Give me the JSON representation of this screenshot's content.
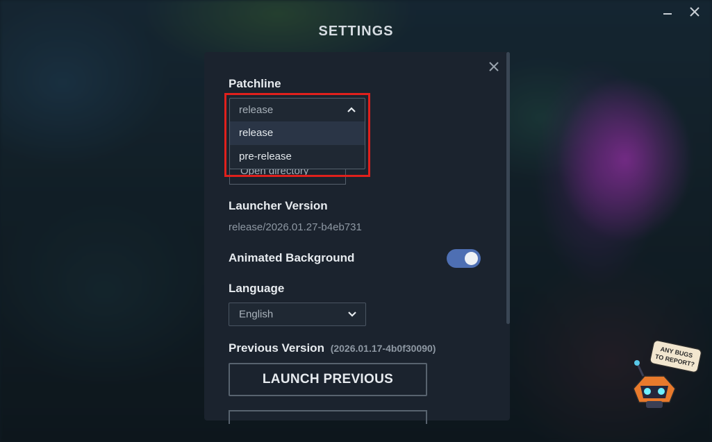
{
  "window": {
    "title": "SETTINGS",
    "minimize_icon": "minimize-icon",
    "close_icon": "close-icon"
  },
  "panel": {
    "close_icon": "close-icon",
    "patchline": {
      "label": "Patchline",
      "selected": "release",
      "options": [
        "release",
        "pre-release"
      ],
      "expanded": true
    },
    "open_directory": {
      "label": "Open directory"
    },
    "launcher_version": {
      "label": "Launcher Version",
      "value": "release/2026.01.27-b4eb731"
    },
    "animated_background": {
      "label": "Animated Background",
      "enabled": true
    },
    "language": {
      "label": "Language",
      "selected": "English"
    },
    "previous_version": {
      "label": "Previous Version",
      "version": "(2026.01.17-4b0f30090)",
      "launch_label": "LAUNCH PREVIOUS"
    }
  },
  "bug_report": {
    "text": "ANY BUGS TO REPORT?"
  },
  "colors": {
    "accent": "#4e6fb3",
    "highlight": "#e0201c",
    "panel_bg": "#1b232e"
  }
}
